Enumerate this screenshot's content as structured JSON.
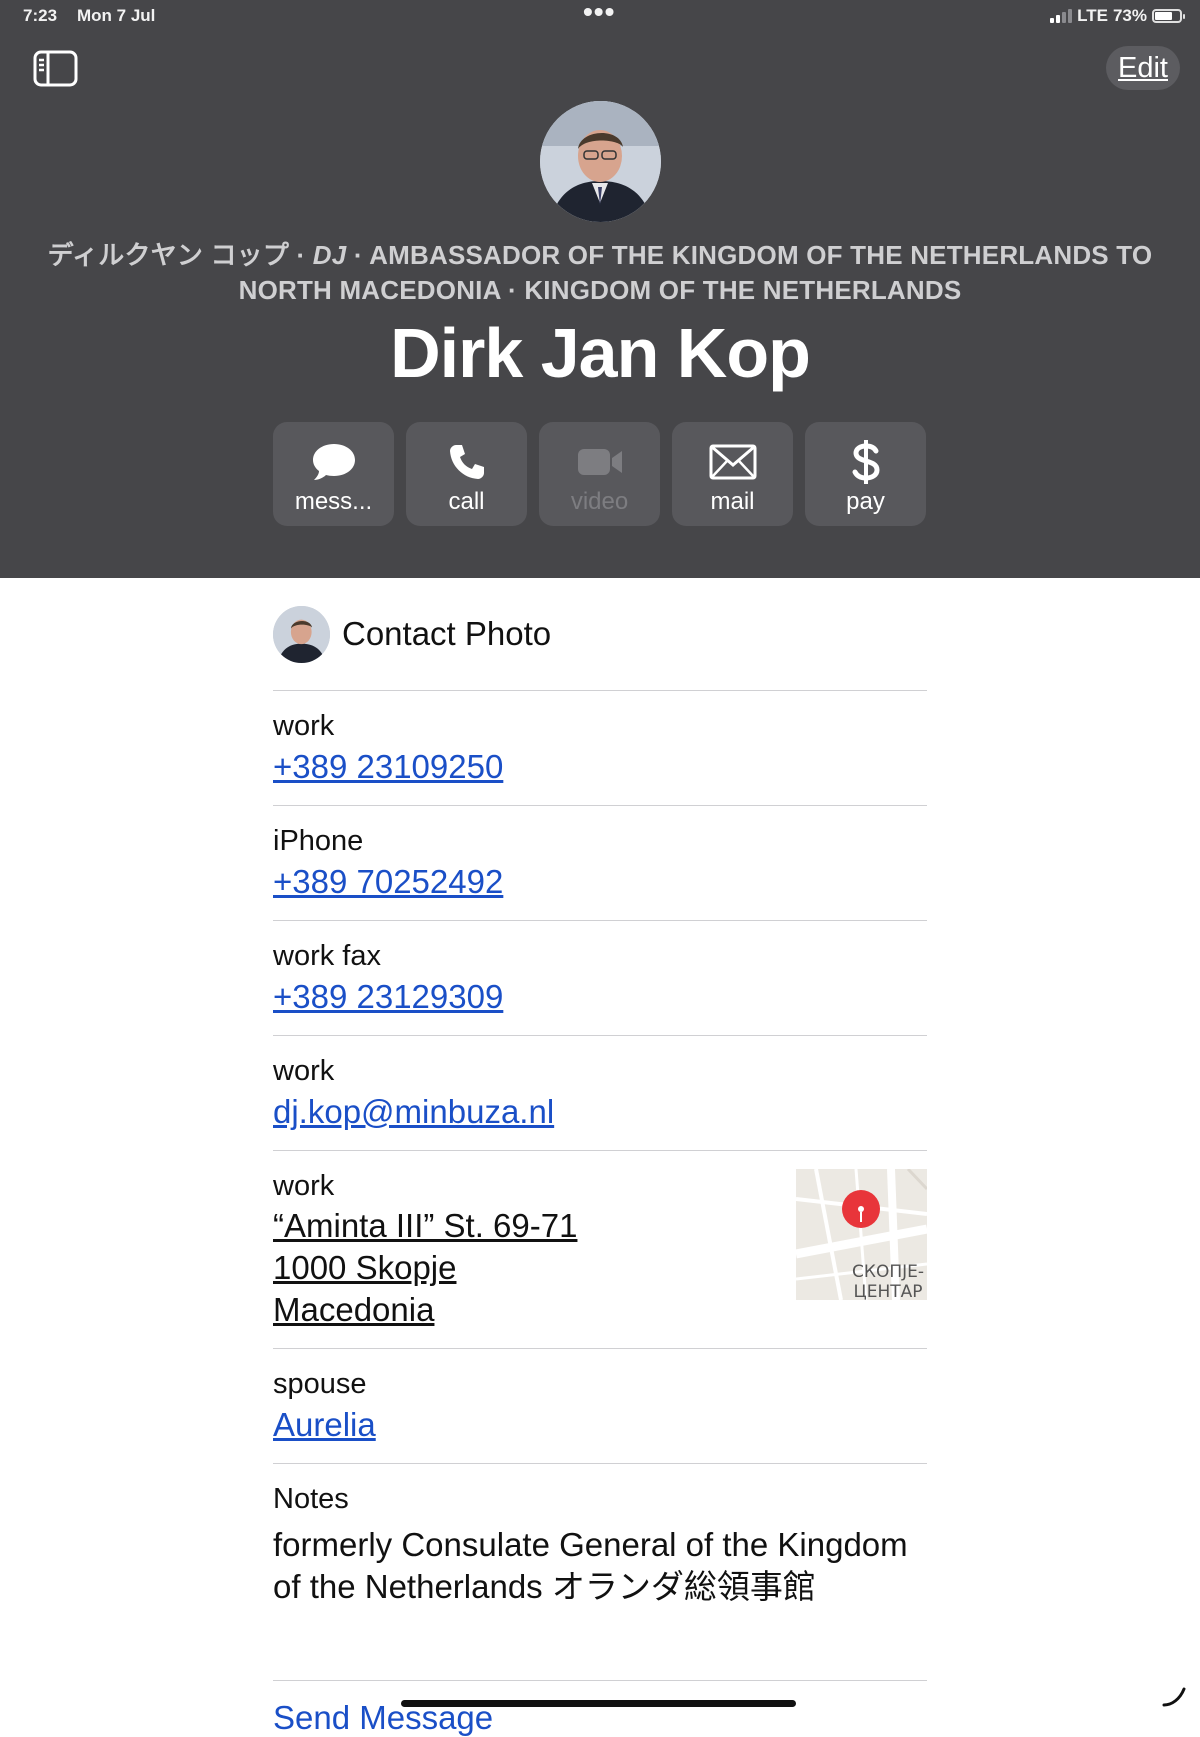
{
  "status_bar": {
    "time": "7:23",
    "date": "Mon 7 Jul",
    "multitask_dots": "•••",
    "network": "LTE",
    "battery_percent": "73%",
    "battery_level": 0.73
  },
  "toolbar": {
    "sidebar_icon": "sidebar-toggle-icon",
    "edit_label": "Edit"
  },
  "header": {
    "subtitle_line1_prefix": "ディルクヤン コップ · ",
    "subtitle_nickname": "DJ",
    "subtitle_line1_suffix": " · AMBASSADOR OF THE KINGDOM OF THE NETHERLANDS TO",
    "subtitle_line2": "NORTH MACEDONIA · KINGDOM OF THE NETHERLANDS",
    "name": "Dirk Jan Kop"
  },
  "actions": [
    {
      "label": "mess...",
      "icon": "message-bubble-icon",
      "enabled": true
    },
    {
      "label": "call",
      "icon": "phone-icon",
      "enabled": true
    },
    {
      "label": "video",
      "icon": "video-camera-icon",
      "enabled": false
    },
    {
      "label": "mail",
      "icon": "envelope-icon",
      "enabled": true
    },
    {
      "label": "pay",
      "icon": "dollar-icon",
      "enabled": true
    }
  ],
  "contact_photo": {
    "label": "Contact Photo"
  },
  "fields": {
    "phone_work": {
      "label": "work",
      "value": "+389 23109250"
    },
    "phone_iphone": {
      "label": "iPhone",
      "value": "+389 70252492"
    },
    "phone_fax": {
      "label": "work fax",
      "value": "+389 23129309"
    },
    "email_work": {
      "label": "work",
      "value": "dj.kop@minbuza.nl"
    },
    "address_work": {
      "label": "work",
      "line1": "“Aminta III” St. 69-71",
      "line2": "1000 Skopje",
      "line3": "Macedonia",
      "map_label_1": "СКОПЈЕ-",
      "map_label_2": "ЦЕНТАР"
    },
    "spouse": {
      "label": "spouse",
      "value": "Aurelia"
    },
    "notes": {
      "label": "Notes",
      "line1": "formerly Consulate General of the Kingdom",
      "line2": "of the Netherlands オランダ総領事館"
    }
  },
  "send_message": "Send Message",
  "colors": {
    "header_bg": "#464649",
    "button_bg": "#58585c",
    "link_blue": "#1a4fc7"
  }
}
